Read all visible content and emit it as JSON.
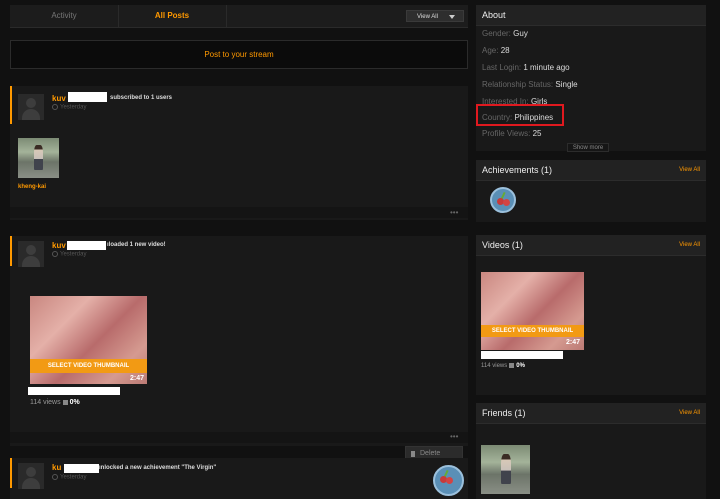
{
  "tabs": {
    "activity": "Activity",
    "all_posts": "All Posts",
    "view_all": "View All"
  },
  "post_stream": {
    "label": "Post to your stream"
  },
  "feed": [
    {
      "username": "kuv",
      "action": "subscribed to 1 users",
      "time": "Yesterday",
      "subscription_name": "kheng-kai"
    },
    {
      "username": "kuv",
      "action": "ıloaded 1 new video!",
      "time": "Yesterday",
      "video": {
        "thumb_label": "SELECT VIDEO THUMBNAIL",
        "duration": "2:47",
        "views": "114 views",
        "rating": "0%"
      }
    },
    {
      "username": "ku",
      "action": "ınlocked a new achievement \"The Virgin\"",
      "time": "Yesterday"
    }
  ],
  "dropdown": {
    "delete_label": "Delete"
  },
  "about": {
    "title": "About",
    "rows": [
      {
        "key": "Gender:",
        "value": "Guy"
      },
      {
        "key": "Age:",
        "value": "28"
      },
      {
        "key": "Last Login:",
        "value": "1 minute ago"
      },
      {
        "key": "Relationship Status:",
        "value": "Single"
      },
      {
        "key": "Interested In:",
        "value": "Girls"
      },
      {
        "key": "Country:",
        "value": "Philippines"
      },
      {
        "key": "Profile Views:",
        "value": "25"
      }
    ],
    "show_more": "Show more"
  },
  "achievements": {
    "title": "Achievements (1)",
    "view_all": "View All"
  },
  "videos": {
    "title": "Videos (1)",
    "view_all": "View All",
    "thumb_label": "SELECT VIDEO THUMBNAIL",
    "duration": "2:47",
    "views": "114 views",
    "rating": "0%"
  },
  "friends": {
    "title": "Friends (1)",
    "view_all": "View All"
  },
  "colors": {
    "accent": "#ff9900",
    "highlight": "#e0191f",
    "background": "#111111",
    "card": "#191919"
  }
}
